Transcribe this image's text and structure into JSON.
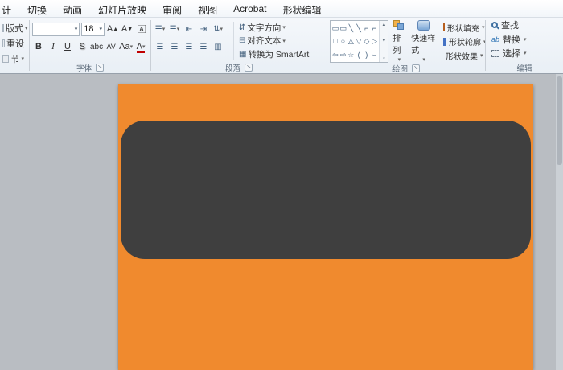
{
  "tabs": {
    "items": [
      "计",
      "切换",
      "动画",
      "幻灯片放映",
      "审阅",
      "视图",
      "Acrobat",
      "形状编辑"
    ]
  },
  "slides": {
    "layout": "版式",
    "reset": "重设",
    "section": "节"
  },
  "font": {
    "label": "字体",
    "size": "18",
    "bold": "B",
    "italic": "I",
    "underline": "U",
    "shadow": "S",
    "strikethrough": "abc",
    "char_spacing": "AV",
    "change_case": "Aa",
    "font_color": "A",
    "grow_font": "A",
    "shrink_font": "A"
  },
  "paragraph": {
    "label": "段落",
    "text_direction": "文字方向",
    "align_text": "对齐文本",
    "smartart": "转换为 SmartArt"
  },
  "drawing": {
    "label": "绘图",
    "arrange": "排列",
    "quick_styles": "快速样式",
    "shape_fill": "形状填充",
    "shape_outline": "形状轮廓",
    "shape_effects": "形状效果",
    "shape_icons": [
      "▭",
      "▭",
      "╲",
      "╲",
      "⌐",
      "⌐",
      "□",
      "○",
      "△",
      "▽",
      "◇",
      "▷",
      "⇦",
      "⇨",
      "☆",
      "(",
      ")",
      "⌣"
    ]
  },
  "editing": {
    "label": "编辑",
    "find": "查找",
    "replace": "替换",
    "select": "选择"
  },
  "colors": {
    "slide": "#F08A2E",
    "shape": "#3F3F3F",
    "canvas": "#B9BDC2"
  }
}
